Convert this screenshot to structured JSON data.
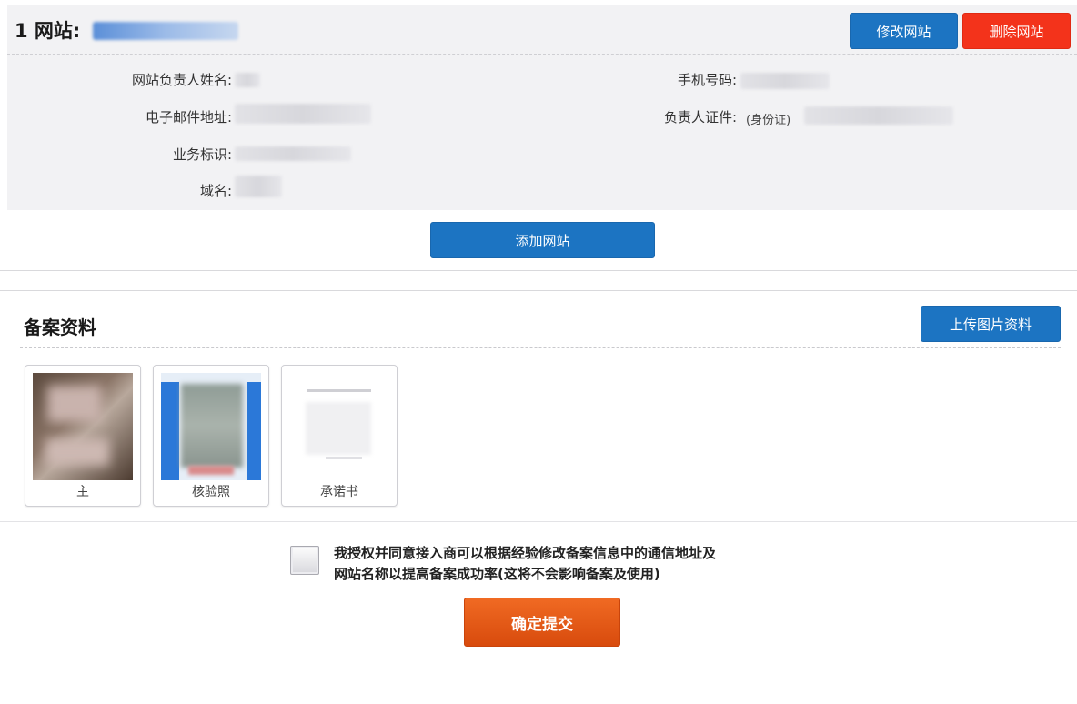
{
  "site": {
    "title": "1 网站:",
    "edit_button": "修改网站",
    "delete_button": "删除网站",
    "fields": {
      "owner_name_label": "网站负责人姓名:",
      "email_label": "电子邮件地址:",
      "business_label": "业务标识:",
      "domain_label": "域名:",
      "phone_label": "手机号码:",
      "id_label": "负责人证件:",
      "id_type": "(身份证)"
    }
  },
  "add_site_button": "添加网站",
  "filing": {
    "title": "备案资料",
    "upload_button": "上传图片资料",
    "cards": [
      {
        "caption": "主"
      },
      {
        "caption": "核验照"
      },
      {
        "caption": "承诺书"
      }
    ]
  },
  "consent": {
    "text_line1": "我授权并同意接入商可以根据经验修改备案信息中的通信地址及",
    "text_line2": "网站名称以提高备案成功率(这将不会影响备案及使用)"
  },
  "submit_button": "确定提交",
  "colors": {
    "primary_blue": "#1c74c2",
    "danger_red": "#f3331b",
    "submit_orange": "#e35a16"
  }
}
